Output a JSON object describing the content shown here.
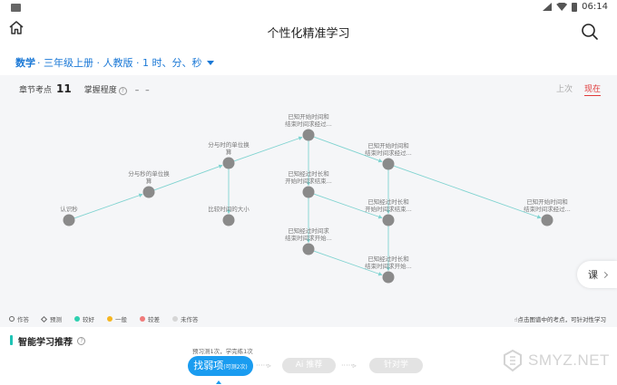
{
  "statusbar": {
    "time": "06:14"
  },
  "header": {
    "title": "个性化精准学习"
  },
  "subject": {
    "strong": "数学",
    "rest": "· 三年级上册 · 人教版 · 1 时、分、秒"
  },
  "stats": {
    "chapter_label": "章节考点",
    "chapter_count": "11",
    "mastery_label": "掌握程度",
    "mastery_value": "– –"
  },
  "period": {
    "prev": "上次",
    "now": "现在"
  },
  "graph": {
    "node_color": "#8a8a8a",
    "edge_color": "#7fd3d0",
    "nodes": [
      {
        "id": "n1",
        "label": [
          "认识秒"
        ]
      },
      {
        "id": "n2",
        "label": [
          "分与秒的单位换",
          "算"
        ]
      },
      {
        "id": "n3",
        "label": [
          "分与时的单位换",
          "算"
        ]
      },
      {
        "id": "n4",
        "label": [
          "比较时间的大小"
        ]
      },
      {
        "id": "n5",
        "label": [
          "已知开始时间和",
          "结束时间求经过..."
        ]
      },
      {
        "id": "n6",
        "label": [
          "已知经过时长和",
          "开始时间求结束..."
        ]
      },
      {
        "id": "n7",
        "label": [
          "已知经过时间求",
          "结束时间求开始..."
        ]
      },
      {
        "id": "n8",
        "label": [
          "已知开始时间和",
          "结束时间求经过..."
        ]
      },
      {
        "id": "n9",
        "label": [
          "已知经过时长和",
          "开始时间求结束..."
        ]
      },
      {
        "id": "n10",
        "label": [
          "已知经过时长和",
          "结束时间求开始..."
        ]
      },
      {
        "id": "n11",
        "label": [
          "已知开始时间和",
          "结束时间求经过..."
        ]
      }
    ],
    "edges": [
      [
        "n1",
        "n2"
      ],
      [
        "n2",
        "n3"
      ],
      [
        "n3",
        "n4"
      ],
      [
        "n3",
        "n5"
      ],
      [
        "n5",
        "n6"
      ],
      [
        "n5",
        "n8"
      ],
      [
        "n6",
        "n7"
      ],
      [
        "n6",
        "n9"
      ],
      [
        "n7",
        "n10"
      ],
      [
        "n8",
        "n9"
      ],
      [
        "n8",
        "n11"
      ],
      [
        "n9",
        "n10"
      ]
    ]
  },
  "course_tab": {
    "label": "课"
  },
  "legend": {
    "items": [
      {
        "label": "作答",
        "kind": "ring"
      },
      {
        "label": "预测",
        "kind": "diamond"
      },
      {
        "label": "较好",
        "kind": "dot",
        "color": "#2fd0b0"
      },
      {
        "label": "一般",
        "kind": "dot",
        "color": "#f5b520"
      },
      {
        "label": "较差",
        "kind": "dot",
        "color": "#f07a7a"
      },
      {
        "label": "未作答",
        "kind": "dot",
        "color": "#d6d6d6"
      }
    ],
    "hint": "点击图谱中的考点，可针对性学习"
  },
  "recommend": {
    "title": "智能学习推荐",
    "note": "预习测1次，学完练1次",
    "step1": "找弱项",
    "step1_sub": "(可测2次)",
    "step2": "Ai 推荐",
    "step3": "针对学",
    "arrow": "·····▹"
  },
  "watermark": {
    "text": "SMYZ.NET"
  }
}
